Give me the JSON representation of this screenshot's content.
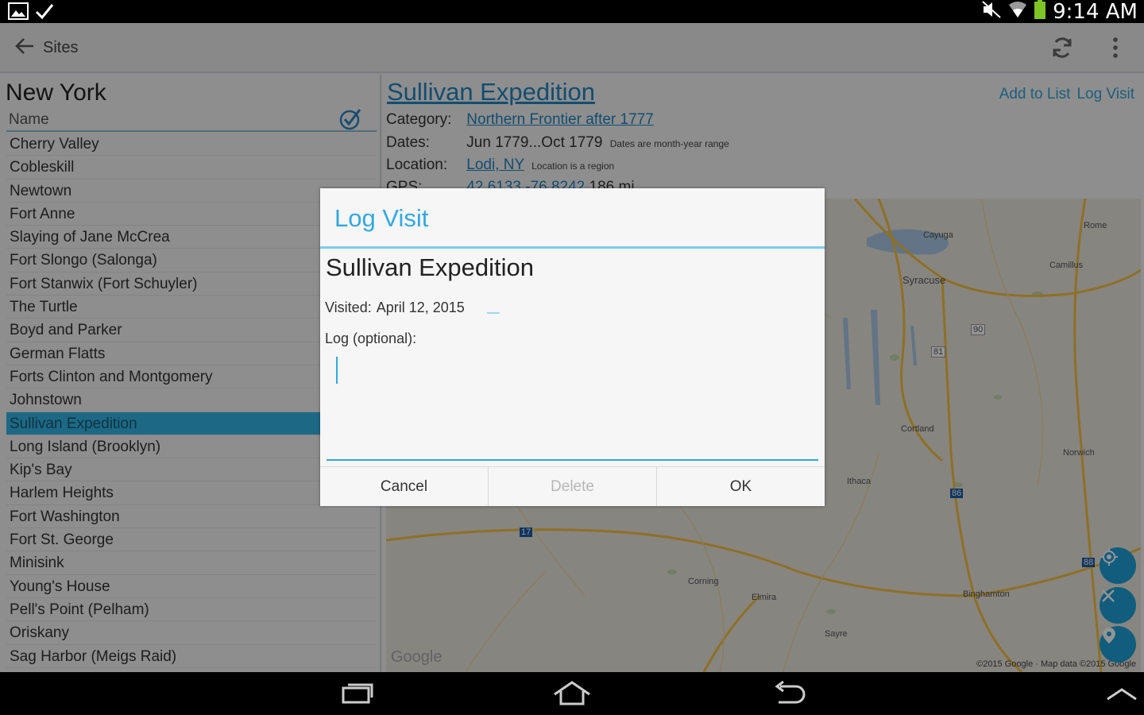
{
  "status_bar": {
    "time": "9:14 AM",
    "left_icons": [
      "image-icon",
      "check-icon"
    ],
    "right_icons": [
      "mute-icon",
      "wifi-icon",
      "battery-icon"
    ],
    "battery_color": "#7ec427"
  },
  "action_bar": {
    "back_label": "Sites",
    "icons": [
      "refresh-icon",
      "overflow-menu-icon"
    ]
  },
  "list": {
    "heading": "New York",
    "column_header": "Name",
    "selected_index": 12,
    "items": [
      "Cherry Valley",
      "Cobleskill",
      "Newtown",
      "Fort Anne",
      "Slaying of Jane McCrea",
      "Fort Slongo (Salonga)",
      "Fort Stanwix (Fort Schuyler)",
      "The Turtle",
      "Boyd and Parker",
      "German Flatts",
      "Forts Clinton and Montgomery",
      "Johnstown",
      "Sullivan Expedition",
      "Long Island (Brooklyn)",
      "Kip's Bay",
      "Harlem Heights",
      "Fort Washington",
      "Fort St. George",
      "Minisink",
      "Young's House",
      "Pell's Point (Pelham)",
      "Oriskany",
      "Sag Harbor (Meigs Raid)"
    ]
  },
  "detail": {
    "title": "Sullivan Expedition",
    "actions": {
      "add_to_list": "Add to List",
      "log_visit": "Log Visit"
    },
    "category_label": "Category:",
    "category_value": "Northern Frontier after 1777",
    "dates_label": "Dates:",
    "dates_value": "Jun 1779...Oct 1779",
    "dates_note": "Dates are month-year range",
    "location_label": "Location:",
    "location_value": "Lodi, NY",
    "location_note": "Location is a region",
    "gps_label": "GPS:",
    "gps_value": "42.6133,-76.8242",
    "gps_distance": "186 mi"
  },
  "map": {
    "place_labels": [
      "Rome",
      "Syracuse",
      "Camillus",
      "Cortland",
      "Norwich",
      "Ithaca",
      "Corning",
      "Elmira",
      "Binghamton",
      "Sayre",
      "Cayuga"
    ],
    "route_shields": [
      "90",
      "81",
      "17",
      "86",
      "88"
    ],
    "watermark": "Google",
    "copyright": "©2015 Google · Map data ©2015 Google",
    "fab_icons": [
      "my-location-icon",
      "close-icon",
      "place-icon"
    ],
    "accent": "#1da1d8"
  },
  "dialog": {
    "title": "Log Visit",
    "site_name": "Sullivan Expedition",
    "visited_label": "Visited:",
    "visited_date": "April 12, 2015",
    "log_label": "Log (optional):",
    "log_value": "",
    "buttons": {
      "cancel": "Cancel",
      "delete": "Delete",
      "ok": "OK"
    },
    "accent": "#33a8dd"
  },
  "nav_bar": {
    "buttons": [
      "recent-apps-icon",
      "home-icon",
      "back-icon",
      "chevron-up-icon"
    ]
  }
}
